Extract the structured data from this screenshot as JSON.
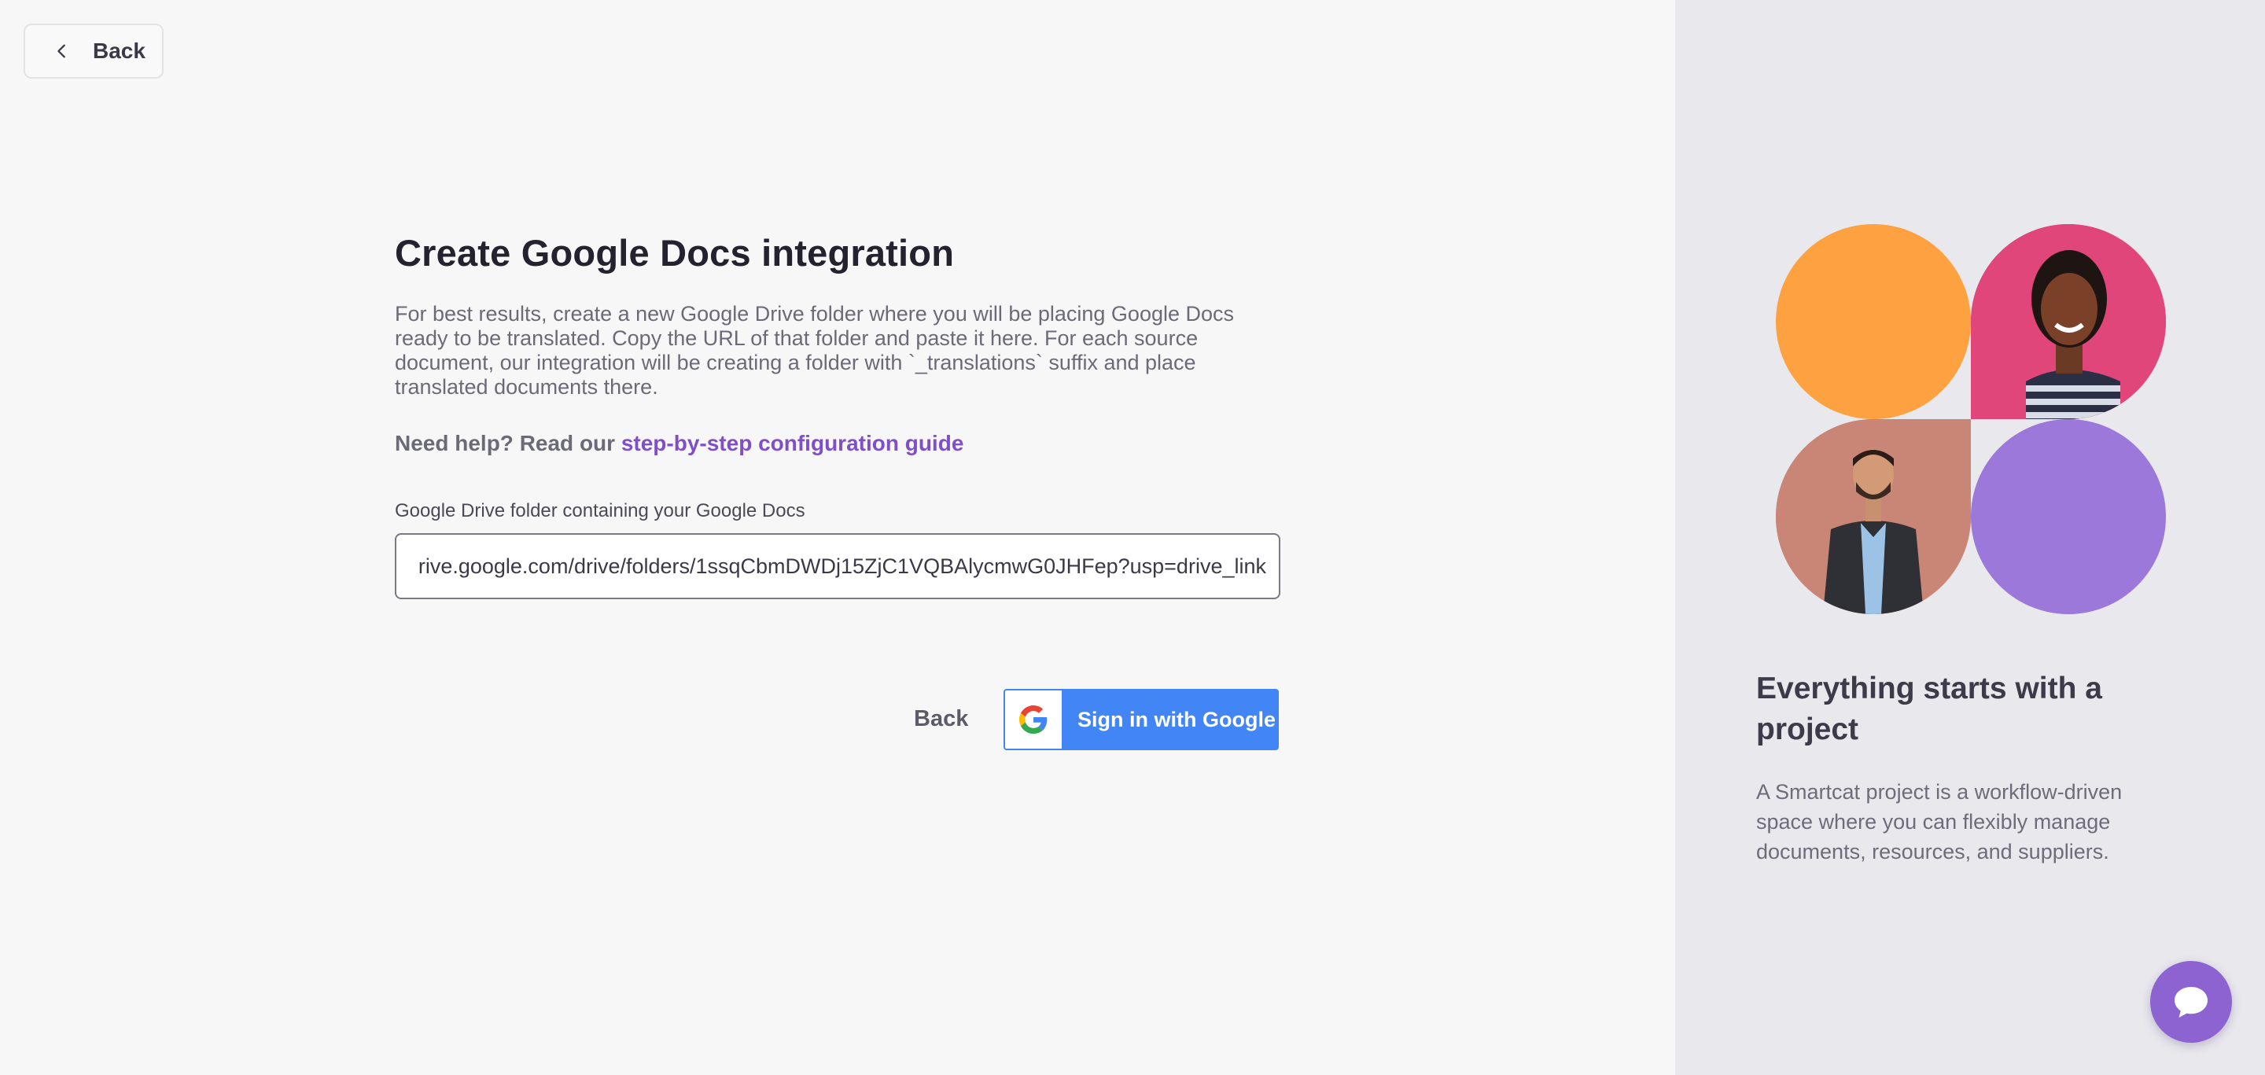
{
  "nav": {
    "back_label": "Back"
  },
  "form": {
    "title": "Create Google Docs integration",
    "description": "For best results, create a new Google Drive folder where you will be placing Google Docs ready to be translated. Copy the URL of that folder and paste it here. For each source document, our integration will be creating a folder with `_translations` suffix and place translated documents there.",
    "help_prefix": "Need help? Read our ",
    "help_link": "step-by-step configuration guide",
    "field_label": "Google Drive folder containing your Google Docs",
    "field_value": "rive.google.com/drive/folders/1ssqCbmDWDj15ZjC1VQBAlycmwG0JHFep?usp=drive_link",
    "back_button": "Back",
    "google_button": "Sign in with Google"
  },
  "promo": {
    "title": "Everything starts with a project",
    "text": "A Smartcat project is a workflow-driven space where you can flexibly manage documents, resources, and suppliers."
  },
  "colors": {
    "accent": "#7e4fc7",
    "google_blue": "#4285f4",
    "orange": "#fea140",
    "pink": "#e1467a",
    "purple": "#9b78da",
    "chat": "#8d62d1"
  },
  "icons": {
    "back": "chevron-left-icon",
    "google": "google-g-icon",
    "chat": "chat-bubble-icon"
  }
}
